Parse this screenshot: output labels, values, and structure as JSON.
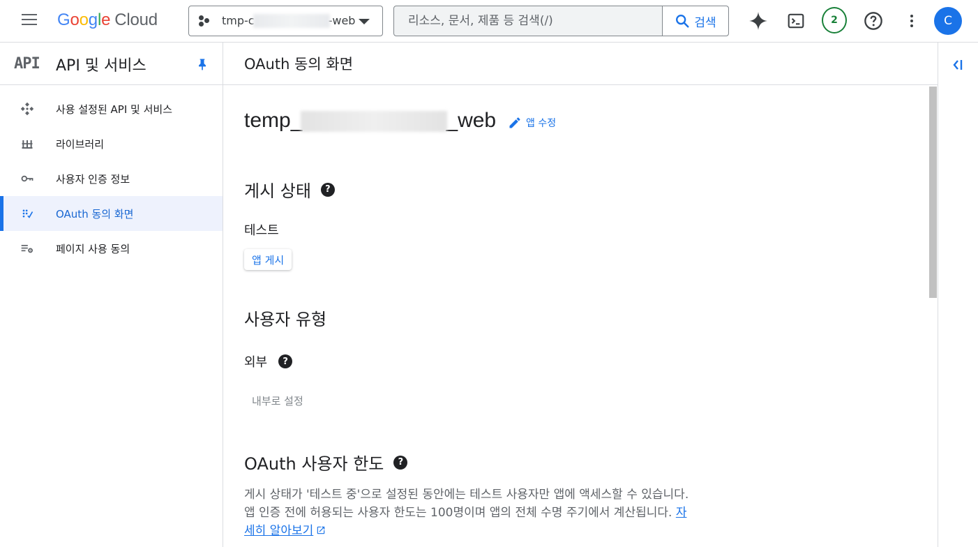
{
  "topbar": {
    "logo_parts": [
      "G",
      "o",
      "o",
      "g",
      "l",
      "e"
    ],
    "logo_cloud": "Cloud",
    "project_prefix": "tmp-c",
    "project_suffix": "-web",
    "search_placeholder": "리소스, 문서, 제품 등 검색(/)",
    "search_button": "검색",
    "notification_count": "2",
    "avatar_letter": "C"
  },
  "sidebar": {
    "logo": "API",
    "title": "API 및 서비스",
    "items": [
      {
        "label": "사용 설정된 API 및 서비스",
        "icon": "enabled-apis-icon",
        "active": false
      },
      {
        "label": "라이브러리",
        "icon": "library-icon",
        "active": false
      },
      {
        "label": "사용자 인증 정보",
        "icon": "key-icon",
        "active": false
      },
      {
        "label": "OAuth 동의 화면",
        "icon": "oauth-consent-icon",
        "active": true
      },
      {
        "label": "페이지 사용 동의",
        "icon": "page-usage-icon",
        "active": false
      }
    ]
  },
  "main": {
    "page_title": "OAuth 동의 화면",
    "app_name_prefix": "temp_",
    "app_name_suffix": "_web",
    "edit_app": "앱 수정",
    "publish_status": {
      "heading": "게시 상태",
      "value": "테스트",
      "button": "앱 게시"
    },
    "user_type": {
      "heading": "사용자 유형",
      "value": "외부",
      "button": "내부로 설정"
    },
    "user_cap": {
      "heading": "OAuth 사용자 한도",
      "description": "게시 상태가 '테스트 중'으로 설정된 동안에는 테스트 사용자만 앱에 액세스할 수 있습니다. 앱 인증 전에 허용되는 사용자 한도는 100명이며 앱의 전체 수명 주기에서 계산됩니다. ",
      "learn_more": "자세히 알아보기"
    }
  },
  "colors": {
    "accent": "#1a73e8",
    "active_bg": "#eef2fd",
    "badge_green": "#188038"
  }
}
